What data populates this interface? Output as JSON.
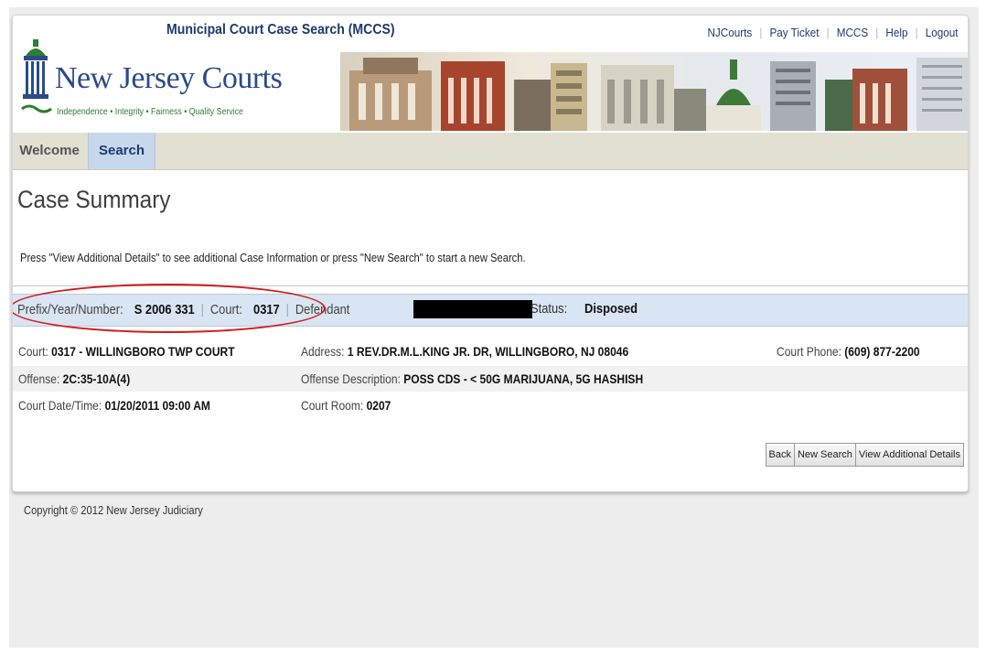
{
  "header": {
    "app_title": "Municipal Court Case Search (MCCS)",
    "links": [
      "NJCourts",
      "Pay Ticket",
      "MCCS",
      "Help",
      "Logout"
    ],
    "logo_name": "New Jersey Courts",
    "logo_tagline": "Independence • Integrity • Fairness • Quality Service"
  },
  "nav": {
    "tabs": [
      "Welcome",
      "Search"
    ],
    "active": "Search"
  },
  "page": {
    "title": "Case Summary",
    "instruction": "Press \"View Additional Details\" to see additional Case Information or press \"New Search\" to start a new Search."
  },
  "summary": {
    "prefix_label": "Prefix/Year/Number:",
    "prefix_value": "S 2006 331",
    "court_label": "Court:",
    "court_value": "0317",
    "defendant_label": "Defendant",
    "status_label": "Status:",
    "status_value": "Disposed"
  },
  "details": {
    "court_label": "Court:",
    "court_value": "0317 - WILLINGBORO TWP COURT",
    "address_label": "Address:",
    "address_value": "1 REV.DR.M.L.KING JR. DR, WILLINGBORO, NJ 08046",
    "phone_label": "Court Phone:",
    "phone_value": "(609) 877-2200",
    "offense_label": "Offense:",
    "offense_value": "2C:35-10A(4)",
    "offense_desc_label": "Offense Description:",
    "offense_desc_value": "POSS CDS - < 50G MARIJUANA, 5G HASHISH",
    "datetime_label": "Court Date/Time:",
    "datetime_value": "01/20/2011 09:00 AM",
    "room_label": "Court Room:",
    "room_value": "0207"
  },
  "buttons": {
    "back": "Back",
    "new_search": "New Search",
    "view_details": "View Additional Details"
  },
  "footer": {
    "copyright": "Copyright © 2012 New Jersey Judiciary"
  },
  "colors": {
    "brand_navy": "#1f3a6e",
    "tagline_green": "#2e7d32",
    "summary_bg": "#d9e5f2",
    "annotation_red": "#d21a1a"
  },
  "icons": {
    "logo": "state-house-dome-icon"
  }
}
